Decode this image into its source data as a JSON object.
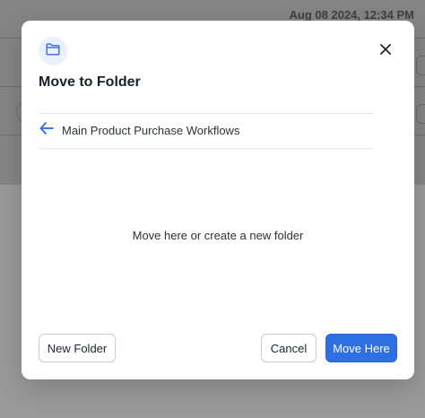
{
  "background": {
    "timestamp": "Aug 08 2024, 12:34 PM"
  },
  "modal": {
    "icon": "folder-icon",
    "title": "Move to Folder",
    "close_icon": "close-icon",
    "breadcrumb": {
      "back_icon": "arrow-left-icon",
      "folder_name": "Main Product Purchase Workflows"
    },
    "empty_message": "Move here or create a new folder",
    "buttons": {
      "new_folder": "New Folder",
      "cancel": "Cancel",
      "move_here": "Move Here"
    }
  },
  "colors": {
    "accent": "#2f6fe4",
    "icon_badge_bg": "#eaf0fd",
    "text_primary": "#1a1f2b"
  }
}
